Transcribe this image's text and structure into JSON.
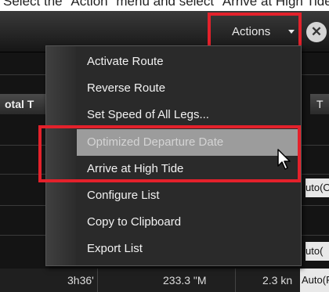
{
  "caption": {
    "text": "Select the \"Action\" menu and select \"Arrive at High Tide\""
  },
  "toolbar": {
    "actions_label": "Actions",
    "close_icon": "close-icon"
  },
  "table": {
    "col_header_left": "otal T",
    "col_header_right": "T",
    "right_cells": [
      "uto(O",
      "uto("
    ],
    "bottom_row": {
      "duration": "3h36'",
      "distance": "233.3 \"M",
      "speed": "2.3 kn",
      "mode": "Auto(Po"
    }
  },
  "menu": {
    "items": [
      {
        "label": "Activate Route",
        "disabled": false
      },
      {
        "label": "Reverse Route",
        "disabled": false
      },
      {
        "label": "Set Speed of All Legs...",
        "disabled": false
      },
      {
        "label": "Optimized Departure Date",
        "disabled": true
      },
      {
        "label": "Arrive at High Tide",
        "disabled": false
      },
      {
        "label": "Configure List",
        "disabled": false
      },
      {
        "label": "Copy to Clipboard",
        "disabled": false
      },
      {
        "label": "Export List",
        "disabled": false
      }
    ]
  },
  "colors": {
    "highlight": "#e3212b",
    "disabled_item_bg": "#9c9c9c"
  }
}
